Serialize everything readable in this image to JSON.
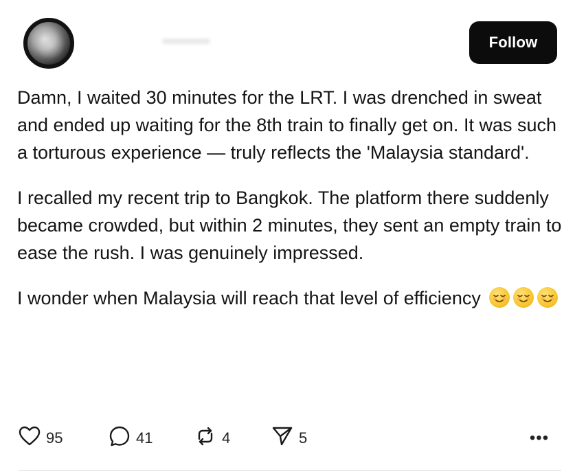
{
  "post": {
    "follow_label": "Follow",
    "paragraphs": [
      "Damn, I waited 30 minutes for the LRT. I was drenched in sweat and ended up waiting for the 8th train to finally get on. It was such a torturous experience — truly reflects the 'Malaysia standard'.",
      "I recalled my recent trip to Bangkok. The platform there suddenly became crowded, but within 2 minutes, they sent an empty train to ease the rush. I was genuinely impressed.",
      "I wonder when Malaysia will reach that level of efficiency"
    ],
    "emojis": [
      "relieved-face-icon",
      "relieved-face-icon",
      "relieved-face-icon"
    ]
  },
  "actions": {
    "likes": "95",
    "replies": "41",
    "reposts": "4",
    "shares": "5",
    "more_label": "•••"
  }
}
